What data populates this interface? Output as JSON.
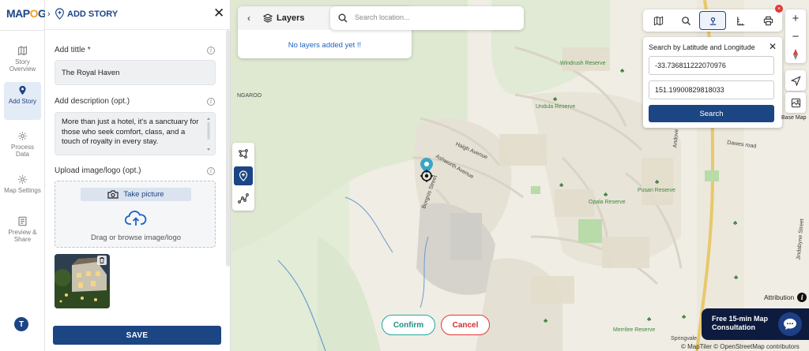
{
  "app": {
    "logo_main": "MAP",
    "logo_accent": "O",
    "logo_end": "G"
  },
  "nav": [
    {
      "label": "Story Overview",
      "icon": "map-book-icon"
    },
    {
      "label": "Add Story",
      "icon": "pin-icon"
    },
    {
      "label": "Process Data",
      "icon": "gear-icon"
    },
    {
      "label": "Map Settings",
      "icon": "gear-icon"
    },
    {
      "label": "Preview & Share",
      "icon": "preview-icon"
    }
  ],
  "user": {
    "initial": "T"
  },
  "panel": {
    "title": "ADD STORY",
    "title_label": "Add tittle *",
    "title_value": "The Royal Haven",
    "desc_label": "Add description (opt.)",
    "desc_value": "More than just a hotel, it's a sanctuary for those who seek comfort, class, and a touch of royalty in every stay.",
    "upload_label": "Upload image/logo (opt.)",
    "take_picture": "Take picture",
    "drag_text": "Drag or browse image/logo",
    "save": "SAVE"
  },
  "layers": {
    "title": "Layers",
    "empty": "No layers added yet !!"
  },
  "search": {
    "placeholder": "Search location..."
  },
  "tools": {
    "badge": "×"
  },
  "latlng": {
    "title": "Search by Latitude and Longitude",
    "lat": "-33.736811222070976",
    "lng": "151.19900829818033",
    "button": "Search"
  },
  "zoom": {
    "in": "+",
    "out": "−"
  },
  "basemap_label": "Base Map",
  "attribution": "Attribution",
  "credit": "© MapTiler © OpenStreetMap contributors",
  "actions": {
    "confirm": "Confirm",
    "cancel": "Cancel"
  },
  "consult": {
    "line1": "Free 15-min Map",
    "line2": "Consultation"
  },
  "map_labels": {
    "windrush": "Windrush Reserve",
    "undula": "Undula Reserve",
    "haigh": "Haigh Avenue",
    "ashworth": "Ashworth Avenue",
    "borgnis": "Borgnis Street",
    "pusan": "Pusan Reserve",
    "opala": "Opala Reserve",
    "dawes": "Dawes road",
    "andove": "Andove",
    "jindabyne": "Jindabyne Street",
    "merrilee": "Merrilee Reserve",
    "springvale": "Springvale",
    "ngaroo": "NGAROO"
  }
}
